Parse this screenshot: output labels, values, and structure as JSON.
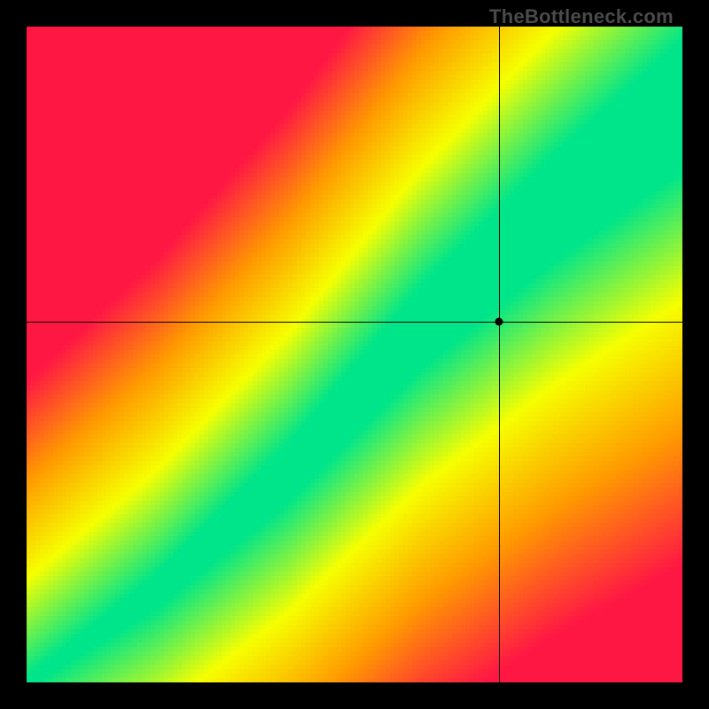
{
  "watermark": "TheBottleneck.com",
  "chart_data": {
    "type": "heatmap",
    "title": "",
    "xlabel": "",
    "ylabel": "",
    "xlim": [
      0,
      1
    ],
    "ylim": [
      0,
      1
    ],
    "crosshair": {
      "x": 0.72,
      "y": 0.55
    },
    "marker": {
      "x": 0.72,
      "y": 0.55
    },
    "optimal_curve": {
      "description": "diagonal band of optimal match (green), surrounded by yellow transition, growing wider toward upper right",
      "control_points": [
        {
          "x": 0.0,
          "y": 0.0
        },
        {
          "x": 0.2,
          "y": 0.14
        },
        {
          "x": 0.4,
          "y": 0.32
        },
        {
          "x": 0.6,
          "y": 0.54
        },
        {
          "x": 0.8,
          "y": 0.72
        },
        {
          "x": 1.0,
          "y": 0.88
        }
      ],
      "band_halfwidth_start": 0.008,
      "band_halfwidth_end": 0.1
    },
    "color_scale": [
      {
        "stop": 0.0,
        "color": "#00e589",
        "meaning": "optimal"
      },
      {
        "stop": 0.33,
        "color": "#f6ff00",
        "meaning": "close"
      },
      {
        "stop": 0.66,
        "color": "#ff9a00",
        "meaning": "moderate bottleneck"
      },
      {
        "stop": 1.0,
        "color": "#ff1744",
        "meaning": "severe bottleneck"
      }
    ],
    "legend": null,
    "grid": false
  }
}
